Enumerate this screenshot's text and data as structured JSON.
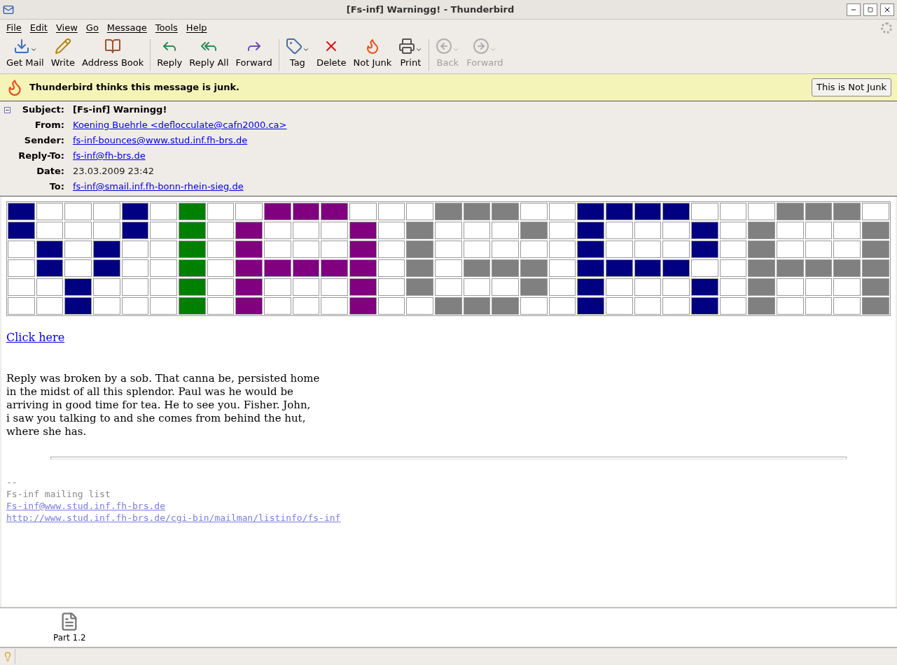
{
  "window": {
    "title": "[Fs-inf] Warningg! - Thunderbird"
  },
  "menu": [
    "File",
    "Edit",
    "View",
    "Go",
    "Message",
    "Tools",
    "Help"
  ],
  "toolbar": [
    {
      "kind": "getmail",
      "label": "Get Mail",
      "dropdown": true,
      "disabled": false,
      "separator_before": false
    },
    {
      "kind": "write",
      "label": "Write",
      "dropdown": false,
      "disabled": false,
      "separator_before": false
    },
    {
      "kind": "addressbook",
      "label": "Address Book",
      "dropdown": false,
      "disabled": false,
      "separator_before": false
    },
    {
      "kind": "reply",
      "label": "Reply",
      "dropdown": false,
      "disabled": false,
      "separator_before": true
    },
    {
      "kind": "replyall",
      "label": "Reply All",
      "dropdown": false,
      "disabled": false,
      "separator_before": false
    },
    {
      "kind": "forward",
      "label": "Forward",
      "dropdown": false,
      "disabled": false,
      "separator_before": false
    },
    {
      "kind": "tag",
      "label": "Tag",
      "dropdown": true,
      "disabled": false,
      "separator_before": true
    },
    {
      "kind": "delete",
      "label": "Delete",
      "dropdown": false,
      "disabled": false,
      "separator_before": false
    },
    {
      "kind": "notjunk",
      "label": "Not Junk",
      "dropdown": false,
      "disabled": false,
      "separator_before": false
    },
    {
      "kind": "print",
      "label": "Print",
      "dropdown": true,
      "disabled": false,
      "separator_before": false
    },
    {
      "kind": "back",
      "label": "Back",
      "dropdown": true,
      "disabled": true,
      "separator_before": true
    },
    {
      "kind": "next",
      "label": "Forward",
      "dropdown": true,
      "disabled": true,
      "separator_before": false
    }
  ],
  "junk_bar": {
    "message": "Thunderbird thinks this message is junk.",
    "button": "This is Not Junk"
  },
  "headers": {
    "expanded": true,
    "fields": [
      {
        "label": "Subject:",
        "value": "[Fs-inf] Warningg!",
        "kind": "bold"
      },
      {
        "label": "From:",
        "value": "Koening Buehrle <deflocculate@cafn2000.ca>",
        "kind": "link"
      },
      {
        "label": "Sender:",
        "value": "fs-inf-bounces@www.stud.inf.fh-brs.de",
        "kind": "link"
      },
      {
        "label": "Reply-To:",
        "value": "fs-inf@fh-brs.de",
        "kind": "link"
      },
      {
        "label": "Date:",
        "value": "23.03.2009 23:42",
        "kind": "text"
      },
      {
        "label": "To:",
        "value": "fs-inf@smail.inf.fh-bonn-rhein-sieg.de",
        "kind": "link"
      }
    ]
  },
  "grid": {
    "rows": [
      {
        "cells": [
          {
            "color": "#000080"
          },
          {
            "color": "#ffffff"
          },
          {
            "color": "#ffffff"
          },
          {
            "color": "#ffffff"
          },
          {
            "color": "#000080"
          },
          {
            "color": "#ffffff"
          },
          {
            "color": "#008000"
          },
          {
            "color": "#ffffff"
          },
          {
            "color": "#ffffff"
          },
          {
            "color": "#800080"
          },
          {
            "color": "#800080"
          },
          {
            "color": "#800080"
          },
          {
            "color": "#ffffff"
          },
          {
            "color": "#ffffff"
          },
          {
            "color": "#ffffff"
          },
          {
            "color": "#808080"
          },
          {
            "color": "#808080"
          },
          {
            "color": "#808080"
          },
          {
            "color": "#ffffff"
          },
          {
            "color": "#ffffff"
          },
          {
            "color": "#000080"
          },
          {
            "color": "#000080"
          },
          {
            "color": "#000080"
          },
          {
            "color": "#000080"
          },
          {
            "color": "#ffffff"
          },
          {
            "color": "#ffffff"
          },
          {
            "color": "#ffffff"
          },
          {
            "color": "#808080"
          },
          {
            "color": "#808080"
          },
          {
            "color": "#808080"
          },
          {
            "color": "#ffffff"
          }
        ]
      },
      {
        "cells": [
          {
            "color": "#000080"
          },
          {
            "color": "#ffffff"
          },
          {
            "color": "#ffffff"
          },
          {
            "color": "#ffffff"
          },
          {
            "color": "#000080"
          },
          {
            "color": "#ffffff"
          },
          {
            "color": "#008000"
          },
          {
            "color": "#ffffff"
          },
          {
            "color": "#800080"
          },
          {
            "color": "#ffffff"
          },
          {
            "color": "#ffffff"
          },
          {
            "color": "#ffffff"
          },
          {
            "color": "#800080"
          },
          {
            "color": "#ffffff"
          },
          {
            "color": "#808080"
          },
          {
            "color": "#ffffff"
          },
          {
            "color": "#ffffff"
          },
          {
            "color": "#ffffff"
          },
          {
            "color": "#808080"
          },
          {
            "color": "#ffffff"
          },
          {
            "color": "#000080"
          },
          {
            "color": "#ffffff"
          },
          {
            "color": "#ffffff"
          },
          {
            "color": "#ffffff"
          },
          {
            "color": "#000080"
          },
          {
            "color": "#ffffff"
          },
          {
            "color": "#808080"
          },
          {
            "color": "#ffffff"
          },
          {
            "color": "#ffffff"
          },
          {
            "color": "#ffffff"
          },
          {
            "color": "#808080"
          }
        ]
      },
      {
        "cells": [
          {
            "color": "#ffffff"
          },
          {
            "color": "#000080"
          },
          {
            "color": "#ffffff"
          },
          {
            "color": "#000080"
          },
          {
            "color": "#ffffff"
          },
          {
            "color": "#ffffff"
          },
          {
            "color": "#008000"
          },
          {
            "color": "#ffffff"
          },
          {
            "color": "#800080"
          },
          {
            "color": "#ffffff"
          },
          {
            "color": "#ffffff"
          },
          {
            "color": "#ffffff"
          },
          {
            "color": "#800080"
          },
          {
            "color": "#ffffff"
          },
          {
            "color": "#808080"
          },
          {
            "color": "#ffffff"
          },
          {
            "color": "#ffffff"
          },
          {
            "color": "#ffffff"
          },
          {
            "color": "#ffffff"
          },
          {
            "color": "#ffffff"
          },
          {
            "color": "#000080"
          },
          {
            "color": "#ffffff"
          },
          {
            "color": "#ffffff"
          },
          {
            "color": "#ffffff"
          },
          {
            "color": "#000080"
          },
          {
            "color": "#ffffff"
          },
          {
            "color": "#808080"
          },
          {
            "color": "#ffffff"
          },
          {
            "color": "#ffffff"
          },
          {
            "color": "#ffffff"
          },
          {
            "color": "#808080"
          }
        ]
      },
      {
        "cells": [
          {
            "color": "#ffffff"
          },
          {
            "color": "#000080"
          },
          {
            "color": "#ffffff"
          },
          {
            "color": "#000080"
          },
          {
            "color": "#ffffff"
          },
          {
            "color": "#ffffff"
          },
          {
            "color": "#008000"
          },
          {
            "color": "#ffffff"
          },
          {
            "color": "#800080"
          },
          {
            "color": "#800080"
          },
          {
            "color": "#800080"
          },
          {
            "color": "#800080"
          },
          {
            "color": "#800080"
          },
          {
            "color": "#ffffff"
          },
          {
            "color": "#808080"
          },
          {
            "color": "#ffffff"
          },
          {
            "color": "#808080"
          },
          {
            "color": "#808080"
          },
          {
            "color": "#808080"
          },
          {
            "color": "#ffffff"
          },
          {
            "color": "#000080"
          },
          {
            "color": "#000080"
          },
          {
            "color": "#000080"
          },
          {
            "color": "#000080"
          },
          {
            "color": "#ffffff"
          },
          {
            "color": "#ffffff"
          },
          {
            "color": "#808080"
          },
          {
            "color": "#808080"
          },
          {
            "color": "#808080"
          },
          {
            "color": "#808080"
          },
          {
            "color": "#808080"
          }
        ]
      },
      {
        "cells": [
          {
            "color": "#ffffff"
          },
          {
            "color": "#ffffff"
          },
          {
            "color": "#000080"
          },
          {
            "color": "#ffffff"
          },
          {
            "color": "#ffffff"
          },
          {
            "color": "#ffffff"
          },
          {
            "color": "#008000"
          },
          {
            "color": "#ffffff"
          },
          {
            "color": "#800080"
          },
          {
            "color": "#ffffff"
          },
          {
            "color": "#ffffff"
          },
          {
            "color": "#ffffff"
          },
          {
            "color": "#800080"
          },
          {
            "color": "#ffffff"
          },
          {
            "color": "#808080"
          },
          {
            "color": "#ffffff"
          },
          {
            "color": "#ffffff"
          },
          {
            "color": "#ffffff"
          },
          {
            "color": "#808080"
          },
          {
            "color": "#ffffff"
          },
          {
            "color": "#000080"
          },
          {
            "color": "#ffffff"
          },
          {
            "color": "#ffffff"
          },
          {
            "color": "#ffffff"
          },
          {
            "color": "#000080"
          },
          {
            "color": "#ffffff"
          },
          {
            "color": "#808080"
          },
          {
            "color": "#ffffff"
          },
          {
            "color": "#ffffff"
          },
          {
            "color": "#ffffff"
          },
          {
            "color": "#808080"
          }
        ]
      },
      {
        "cells": [
          {
            "color": "#ffffff"
          },
          {
            "color": "#ffffff"
          },
          {
            "color": "#000080"
          },
          {
            "color": "#ffffff"
          },
          {
            "color": "#ffffff"
          },
          {
            "color": "#ffffff"
          },
          {
            "color": "#008000"
          },
          {
            "color": "#ffffff"
          },
          {
            "color": "#800080"
          },
          {
            "color": "#ffffff"
          },
          {
            "color": "#ffffff"
          },
          {
            "color": "#ffffff"
          },
          {
            "color": "#800080"
          },
          {
            "color": "#ffffff"
          },
          {
            "color": "#ffffff"
          },
          {
            "color": "#808080"
          },
          {
            "color": "#808080"
          },
          {
            "color": "#808080"
          },
          {
            "color": "#ffffff"
          },
          {
            "color": "#ffffff"
          },
          {
            "color": "#000080"
          },
          {
            "color": "#ffffff"
          },
          {
            "color": "#ffffff"
          },
          {
            "color": "#ffffff"
          },
          {
            "color": "#000080"
          },
          {
            "color": "#ffffff"
          },
          {
            "color": "#808080"
          },
          {
            "color": "#ffffff"
          },
          {
            "color": "#ffffff"
          },
          {
            "color": "#ffffff"
          },
          {
            "color": "#808080"
          }
        ]
      }
    ]
  },
  "body": {
    "link": "Click here",
    "lines": [
      "Reply was broken by a sob. That canna be, persisted home",
      "in the midst of all this splendor. Paul was he would be",
      "arriving in good time for tea. He to see you. Fisher. John,",
      "i saw you talking to and she comes from behind the hut,",
      "where she has."
    ]
  },
  "signature": {
    "lines": [
      "--",
      "Fs-inf mailing list"
    ],
    "links": [
      "Fs-inf@www.stud.inf.fh-brs.de",
      "http://www.stud.inf.fh-brs.de/cgi-bin/mailman/listinfo/fs-inf"
    ]
  },
  "attachments": [
    {
      "name": "Part 1.2"
    }
  ]
}
